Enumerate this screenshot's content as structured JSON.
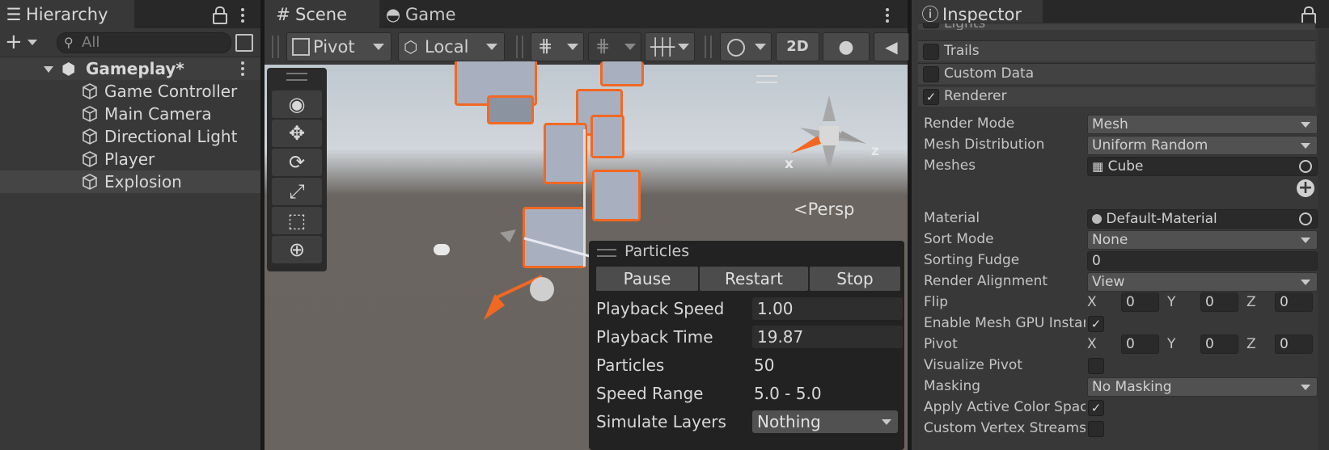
{
  "hierarchy": {
    "tab_label": "Hierarchy",
    "search_placeholder": "All",
    "root": "Gameplay*",
    "items": [
      "Game Controller",
      "Main Camera",
      "Directional Light",
      "Player",
      "Explosion"
    ],
    "selected": "Explosion"
  },
  "scene": {
    "tabs": [
      "Scene",
      "Game"
    ],
    "toolbar": {
      "pivot": "Pivot",
      "local": "Local",
      "mode_2d": "2D"
    },
    "persp_label": "Persp",
    "gizmo_axes": {
      "x": "x",
      "z": "z"
    },
    "tools": [
      "view-tool-icon",
      "move-tool-icon",
      "rotate-tool-icon",
      "scale-tool-icon",
      "rect-tool-icon",
      "transform-tool-icon"
    ]
  },
  "particles": {
    "title": "Particles",
    "buttons": [
      "Pause",
      "Restart",
      "Stop"
    ],
    "playback_speed_label": "Playback Speed",
    "playback_speed": "1.00",
    "playback_time_label": "Playback Time",
    "playback_time": "19.87",
    "particles_label": "Particles",
    "particles_count": "50",
    "speed_range_label": "Speed Range",
    "speed_range": "5.0 - 5.0",
    "simulate_layers_label": "Simulate Layers",
    "simulate_layers": "Nothing"
  },
  "inspector": {
    "tab_label": "Inspector",
    "sections": {
      "lights": "Lights",
      "trails": "Trails",
      "custom_data": "Custom Data",
      "renderer": "Renderer"
    },
    "render_mode": {
      "label": "Render Mode",
      "value": "Mesh"
    },
    "mesh_distribution": {
      "label": "Mesh Distribution",
      "value": "Uniform Random"
    },
    "meshes": {
      "label": "Meshes",
      "value": "Cube"
    },
    "material": {
      "label": "Material",
      "value": "Default-Material"
    },
    "sort_mode": {
      "label": "Sort Mode",
      "value": "None"
    },
    "sorting_fudge": {
      "label": "Sorting Fudge",
      "value": "0"
    },
    "render_alignment": {
      "label": "Render Alignment",
      "value": "View"
    },
    "flip": {
      "label": "Flip",
      "x": "0",
      "y": "0",
      "z": "0"
    },
    "enable_gpu": {
      "label": "Enable Mesh GPU Instar",
      "checked": true
    },
    "pivot": {
      "label": "Pivot",
      "x": "0",
      "y": "0",
      "z": "0"
    },
    "visualize_pivot": {
      "label": "Visualize Pivot",
      "checked": false
    },
    "masking": {
      "label": "Masking",
      "value": "No Masking"
    },
    "apply_color_space": {
      "label": "Apply Active Color Spac",
      "checked": true
    },
    "custom_vertex_streams": {
      "label": "Custom Vertex Streams",
      "checked": false
    },
    "axis_labels": {
      "x": "X",
      "y": "Y",
      "z": "Z"
    }
  },
  "colors": {
    "selection_orange": "#f26822",
    "panel_bg": "#383838",
    "scene_ground": "#6a6560"
  }
}
